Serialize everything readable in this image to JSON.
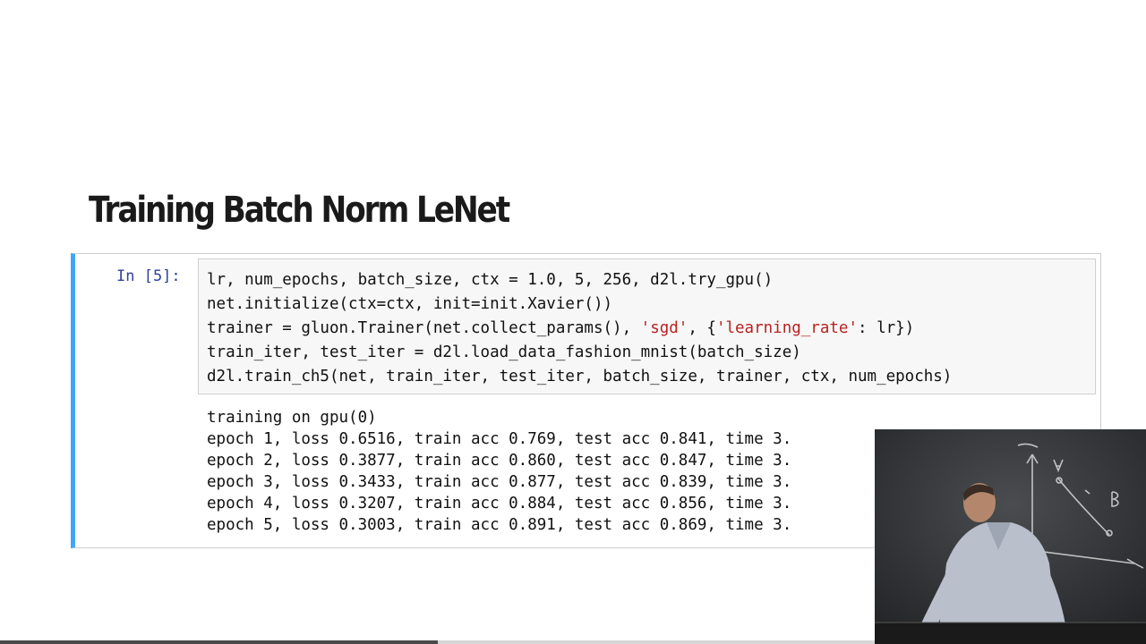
{
  "slide": {
    "title": "Training Batch Norm LeNet"
  },
  "cell": {
    "prompt": "In [5]:",
    "code": [
      [
        {
          "t": "lr, num_epochs, batch_size, ctx = 1.0, 5, 256, d2l.try_gpu()"
        }
      ],
      [
        {
          "t": "net.initialize(ctx=ctx, init=init.Xavier())"
        }
      ],
      [
        {
          "t": "trainer = gluon.Trainer(net.collect_params(), "
        },
        {
          "t": "'sgd'",
          "s": true
        },
        {
          "t": ", {"
        },
        {
          "t": "'learning_rate'",
          "s": true
        },
        {
          "t": ": lr})"
        }
      ],
      [
        {
          "t": "train_iter, test_iter = d2l.load_data_fashion_mnist(batch_size)"
        }
      ],
      [
        {
          "t": "d2l.train_ch5(net, train_iter, test_iter, batch_size, trainer, ctx, num_epochs)"
        }
      ]
    ],
    "output": [
      "training on gpu(0)",
      "epoch 1, loss 0.6516, train acc 0.769, test acc 0.841, time 3.",
      "epoch 2, loss 0.3877, train acc 0.860, test acc 0.847, time 3.",
      "epoch 3, loss 0.3433, train acc 0.877, test acc 0.839, time 3.",
      "epoch 4, loss 0.3207, train acc 0.884, test acc 0.856, time 3.",
      "epoch 5, loss 0.3003, train acc 0.891, test acc 0.869, time 3."
    ]
  },
  "video": {
    "progress": 0.5
  },
  "colors": {
    "cell_accent": "#42a5f5",
    "prompt": "#303f9f",
    "string": "#ba2121"
  }
}
